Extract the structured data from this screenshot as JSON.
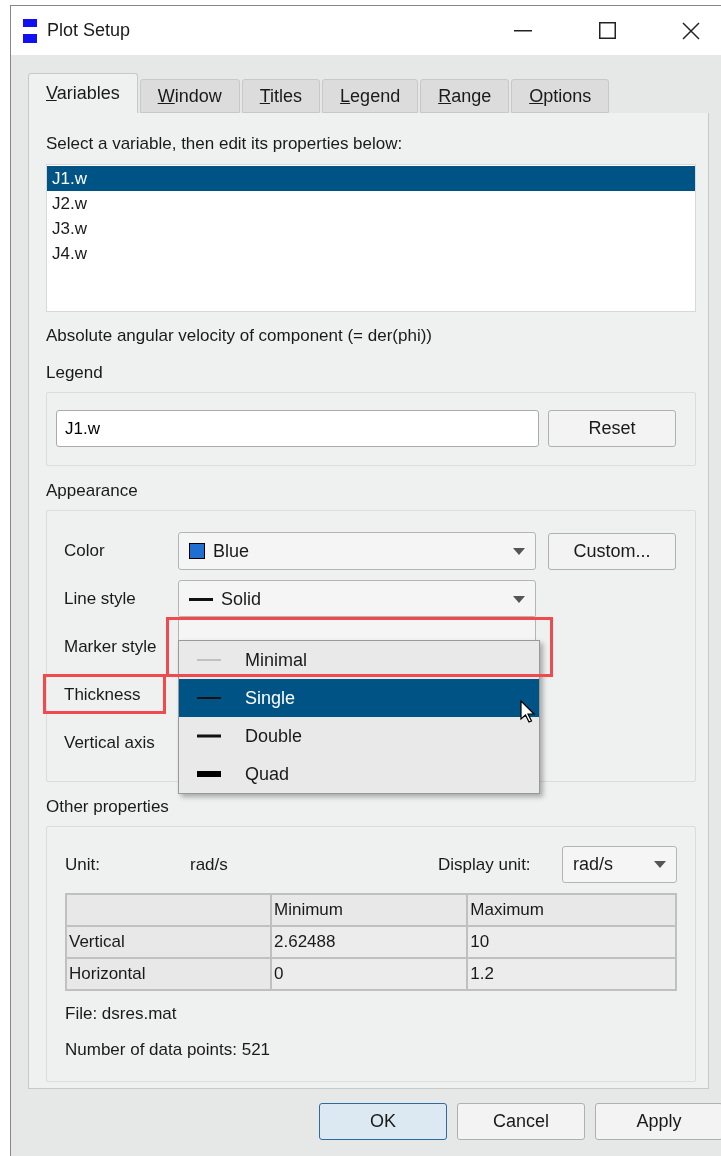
{
  "window": {
    "title": "Plot Setup"
  },
  "tabs": [
    {
      "label": "Variables",
      "selected": true
    },
    {
      "label": "Window",
      "selected": false
    },
    {
      "label": "Titles",
      "selected": false
    },
    {
      "label": "Legend",
      "selected": false
    },
    {
      "label": "Range",
      "selected": false
    },
    {
      "label": "Options",
      "selected": false
    }
  ],
  "variables": {
    "prompt": "Select a variable, then edit its properties below:",
    "items": [
      {
        "label": "J1.w",
        "selected": true
      },
      {
        "label": "J2.w",
        "selected": false
      },
      {
        "label": "J3.w",
        "selected": false
      },
      {
        "label": "J4.w",
        "selected": false
      }
    ],
    "description": "Absolute angular velocity of component (= der(phi))"
  },
  "legend": {
    "title": "Legend",
    "value": "J1.w",
    "button": "Reset"
  },
  "appearance": {
    "title": "Appearance",
    "rows": [
      {
        "kind": "color",
        "label": "Color",
        "value": "Blue",
        "color": "#1f6fd0",
        "button": "Custom...",
        "highlighted": false
      },
      {
        "kind": "line",
        "label": "Line style",
        "value": "Solid",
        "highlighted": false
      },
      {
        "kind": "empty",
        "label": "Marker style",
        "highlighted": false
      },
      {
        "kind": "label",
        "label": "Thickness",
        "highlighted": true
      },
      {
        "kind": "label",
        "label": "Vertical axis",
        "highlighted": false
      }
    ]
  },
  "dropdown": {
    "options": [
      {
        "kind": "minimal",
        "label": "Minimal",
        "selected": false,
        "highlighted": true
      },
      {
        "kind": "single",
        "label": "Single",
        "selected": true,
        "highlighted": false
      },
      {
        "kind": "double",
        "label": "Double",
        "selected": false,
        "highlighted": false
      },
      {
        "kind": "quad",
        "label": "Quad",
        "selected": false,
        "highlighted": false
      }
    ]
  },
  "other": {
    "title": "Other properties",
    "unit_label": "Unit:",
    "unit": "rad/s",
    "display_unit_label": "Display unit:",
    "display_unit": "rad/s",
    "table": {
      "columns": [
        "Minimum",
        "Maximum"
      ],
      "rows": [
        {
          "name": "Vertical",
          "cells": [
            "2.62488",
            "10"
          ]
        },
        {
          "name": "Horizontal",
          "cells": [
            "0",
            "1.2"
          ]
        }
      ]
    },
    "file": "File: dsres.mat",
    "points": "Number of data points: 521"
  },
  "buttons": [
    {
      "label": "OK",
      "default": true
    },
    {
      "label": "Cancel",
      "default": false
    },
    {
      "label": "Apply",
      "default": false
    }
  ]
}
